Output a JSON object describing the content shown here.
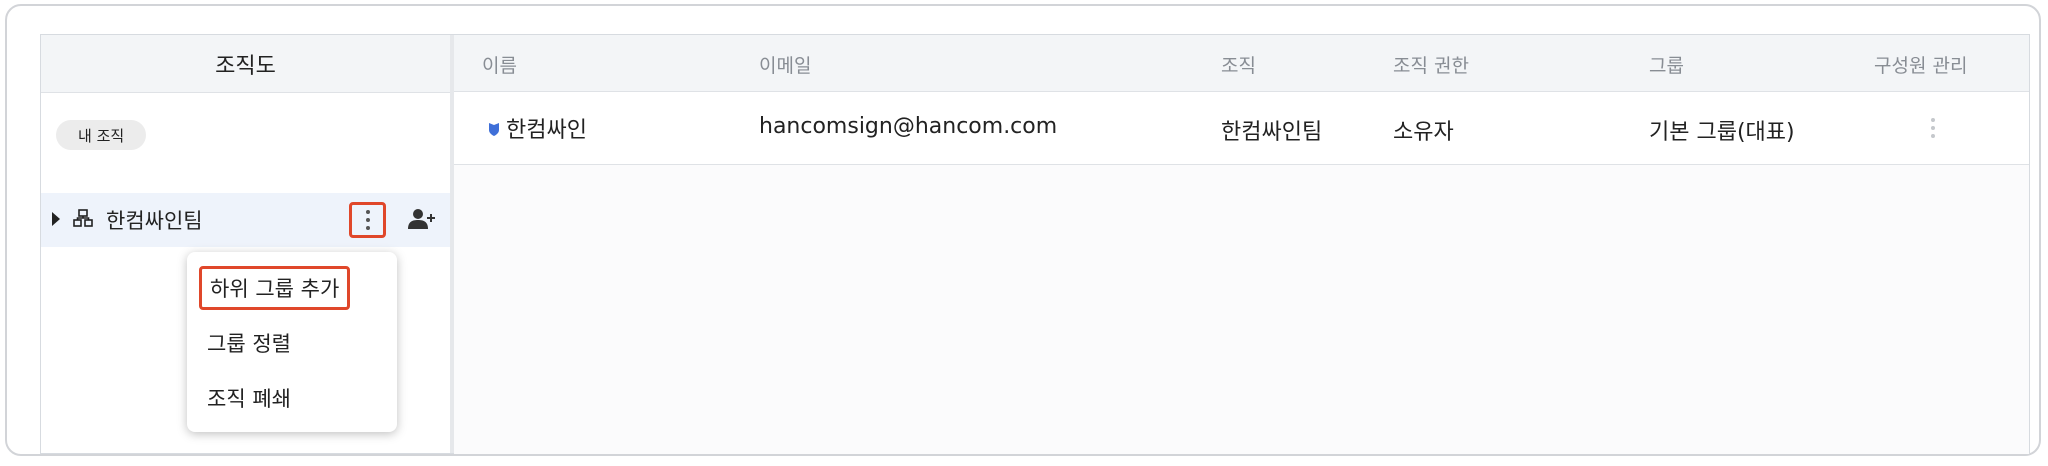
{
  "sidebar": {
    "title": "조직도",
    "my_org_chip": "내 조직",
    "org_name": "한컴싸인팀",
    "icons": {
      "expand": "caret-right-icon",
      "org": "org-chart-icon",
      "more": "more-vertical-icon",
      "add_member": "person-add-icon"
    }
  },
  "context_menu": {
    "items": [
      {
        "label": "하위 그룹 추가",
        "highlighted": true
      },
      {
        "label": "그룹 정렬",
        "highlighted": false
      },
      {
        "label": "조직 폐쇄",
        "highlighted": false
      }
    ]
  },
  "table": {
    "columns": [
      "이름",
      "이메일",
      "조직",
      "조직 권한",
      "그룹",
      "구성원 관리"
    ],
    "rows": [
      {
        "name": "한컴싸인",
        "email": "hancomsign@hancom.com",
        "org": "한컴싸인팀",
        "role": "소유자",
        "group": "기본 그룹(대표)",
        "badge_icon": "shield-icon",
        "manage_icon": "more-vertical-icon"
      }
    ]
  },
  "colors": {
    "highlight_border": "#e0472a",
    "selected_row_bg": "#eef3fb",
    "header_bg": "#f3f5f7",
    "badge_blue": "#3f6fd8"
  }
}
